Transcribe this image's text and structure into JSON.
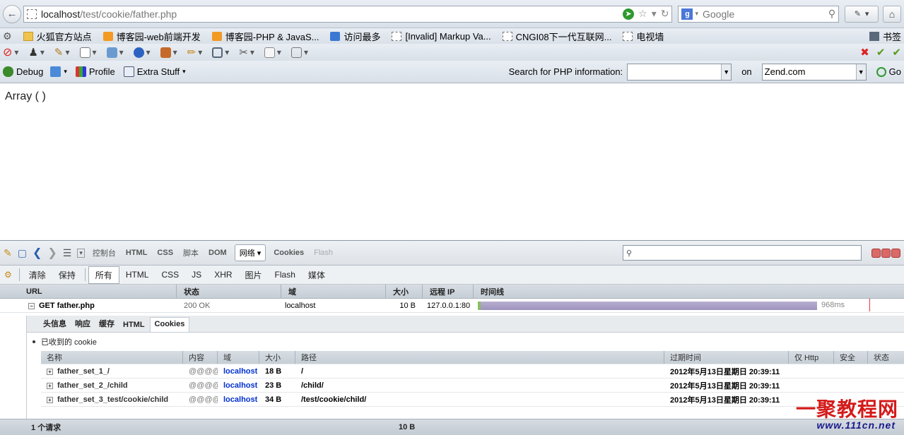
{
  "browser": {
    "url_host": "localhost",
    "url_path": "/test/cookie/father.php",
    "search_placeholder": "Google",
    "search_engine_letter": "g"
  },
  "bookmarks": {
    "items": [
      {
        "label": "火狐官方站点",
        "icon": "folder-icon"
      },
      {
        "label": "博客园-web前端开发",
        "icon": "rss-icon"
      },
      {
        "label": "博客园-PHP & JavaS...",
        "icon": "rss-icon"
      },
      {
        "label": "访问最多",
        "icon": "search-folder-icon"
      },
      {
        "label": "[Invalid] Markup Va...",
        "icon": "page-icon"
      },
      {
        "label": "CNGI08下一代互联网...",
        "icon": "page-icon"
      },
      {
        "label": "电视墙",
        "icon": "page-icon"
      }
    ],
    "bookmarks_menu": "书签"
  },
  "zend_toolbar": {
    "debug": "Debug",
    "profile": "Profile",
    "extra": "Extra Stuff",
    "search_label": "Search for PHP information:",
    "on_label": "on",
    "site_value": "Zend.com",
    "go": "Go"
  },
  "page": {
    "body_text": "Array ( )"
  },
  "firebug": {
    "tabs": [
      "控制台",
      "HTML",
      "CSS",
      "脚本",
      "DOM",
      "网络",
      "Cookies",
      "Flash"
    ],
    "active_tab": "网络",
    "net_buttons": [
      "清除",
      "保持"
    ],
    "net_filters": [
      "所有",
      "HTML",
      "CSS",
      "JS",
      "XHR",
      "图片",
      "Flash",
      "媒体"
    ],
    "net_columns": [
      "URL",
      "状态",
      "域",
      "大小",
      "远程 IP",
      "时间线"
    ],
    "request": {
      "url": "GET father.php",
      "status": "200 OK",
      "domain": "localhost",
      "size": "10 B",
      "remote_ip": "127.0.0.1:80",
      "time": "968ms",
      "timeline_fraction": 1.0
    },
    "detail_tabs": [
      "头信息",
      "响应",
      "缓存",
      "HTML",
      "Cookies"
    ],
    "detail_active": "Cookies",
    "received_label": "已收到的 cookie",
    "cookie_columns": [
      "名称",
      "内容",
      "域",
      "大小",
      "路径",
      "过期时间",
      "仅 Http",
      "安全",
      "状态"
    ],
    "cookies": [
      {
        "name": "father_set_1_/",
        "content": "@@@@",
        "domain": "localhost",
        "size": "18 B",
        "path": "/",
        "expires": "2012年5月13日星期日 20:39:11"
      },
      {
        "name": "father_set_2_/child",
        "content": "@@@@",
        "domain": "localhost",
        "size": "23 B",
        "path": "/child/",
        "expires": "2012年5月13日星期日 20:39:11"
      },
      {
        "name": "father_set_3_test/cookie/child",
        "content": "@@@@",
        "domain": "localhost",
        "size": "34 B",
        "path": "/test/cookie/child/",
        "expires": "2012年5月13日星期日 20:39:11"
      }
    ],
    "footer_count": "1 个请求",
    "footer_size": "10 B"
  },
  "watermark": {
    "brand": "一聚教程网",
    "domain": "www.111cn.net"
  },
  "colors": {
    "accent_link": "#0030d0",
    "timeline": "#9e93bd",
    "brand_red": "#d41a1a"
  }
}
